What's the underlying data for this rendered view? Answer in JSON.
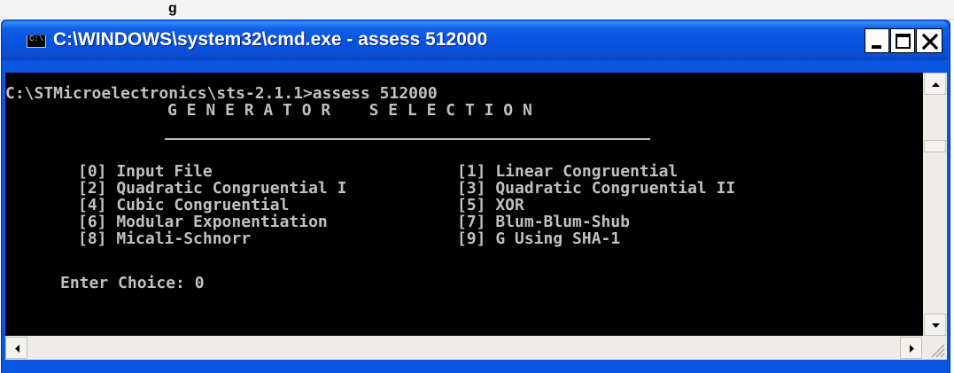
{
  "outer_caption": "g",
  "window": {
    "title": "C:\\WINDOWS\\system32\\cmd.exe - assess 512000",
    "icon": "console-app-icon",
    "icon_text": "C:\\"
  },
  "controls": {
    "minimize": "minimize-icon",
    "maximize": "maximize-icon",
    "close": "close-icon"
  },
  "console": {
    "prompt_line": "C:\\STMicroelectronics\\sts-2.1.1>assess 512000",
    "heading": "G E N E R A T O R    S E L E C T I O N",
    "options": [
      {
        "left": "[0] Input File",
        "right": "[1] Linear Congruential"
      },
      {
        "left": "[2] Quadratic Congruential I",
        "right": "[3] Quadratic Congruential II"
      },
      {
        "left": "[4] Cubic Congruential",
        "right": "[5] XOR"
      },
      {
        "left": "[6] Modular Exponentiation",
        "right": "[7] Blum-Blum-Shub"
      },
      {
        "left": "[8] Micali-Schnorr",
        "right": "[9] G Using SHA-1"
      }
    ],
    "input_label": "Enter Choice: ",
    "input_value": "0"
  },
  "scrollbars": {
    "up": "scroll-up-icon",
    "down": "scroll-down-icon",
    "left": "scroll-left-icon",
    "right": "scroll-right-icon",
    "grip": "resize-grip-icon"
  },
  "colors": {
    "titlebar": "#0a56e3",
    "console_bg": "#000000",
    "console_text": "#c0c0c0",
    "close_button": "#ffffff"
  }
}
